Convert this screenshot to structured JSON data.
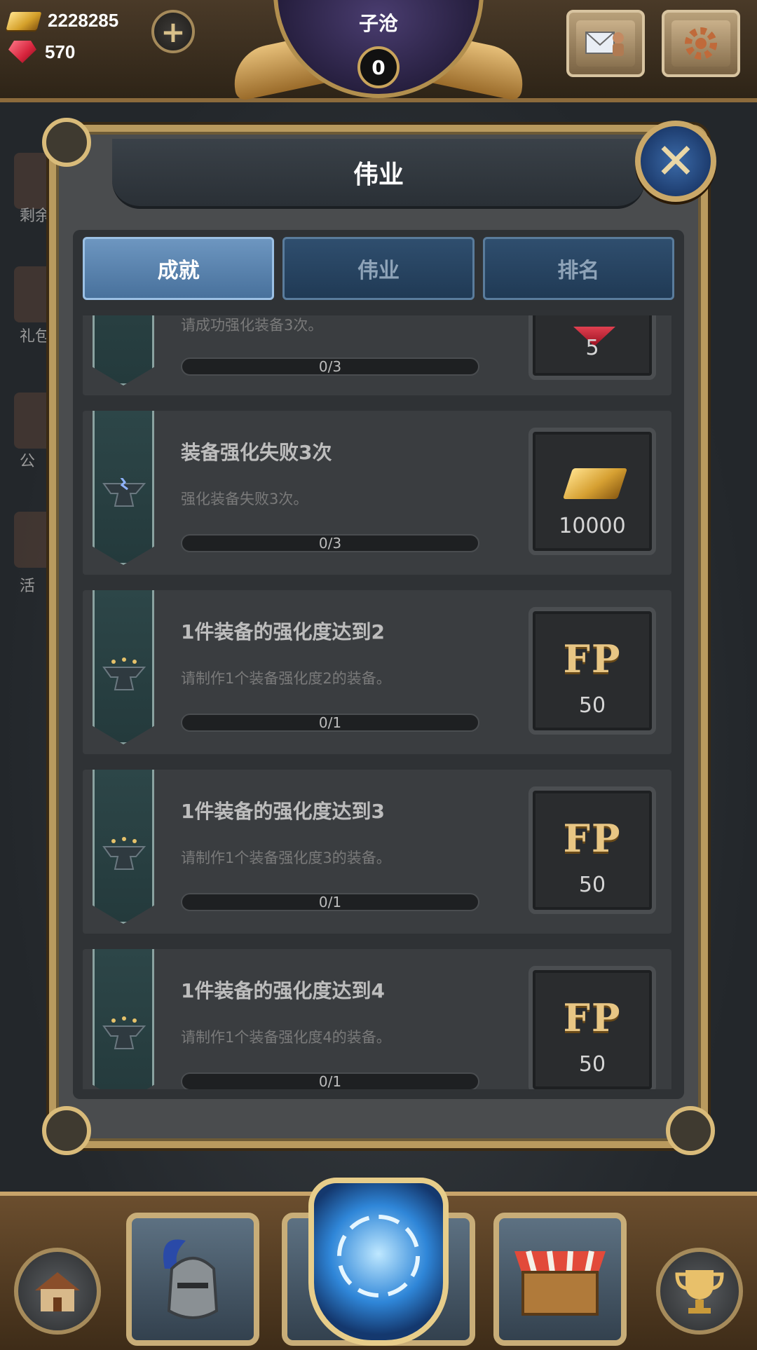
{
  "resources": {
    "gold": "2228285",
    "gems": "570"
  },
  "player": {
    "name": "子沧",
    "level": "0"
  },
  "side_labels": [
    "剩余",
    "礼包",
    "公",
    "活"
  ],
  "panel": {
    "title": "伟业"
  },
  "tabs": [
    {
      "label": "成就",
      "active": true
    },
    {
      "label": "伟业",
      "active": false
    },
    {
      "label": "排名",
      "active": false
    }
  ],
  "achievements": [
    {
      "title": "",
      "description": "请成功强化装备3次。",
      "progress": "0/3",
      "progress_fraction": 0,
      "reward_type": "ruby",
      "reward_amount": "5"
    },
    {
      "title": "装备强化失败3次",
      "description": "强化装备失败3次。",
      "progress": "0/3",
      "progress_fraction": 0,
      "reward_type": "gold",
      "reward_amount": "10000"
    },
    {
      "title": "1件装备的强化度达到2",
      "description": "请制作1个装备强化度2的装备。",
      "progress": "0/1",
      "progress_fraction": 0,
      "reward_type": "fp",
      "reward_icon_text": "FP",
      "reward_amount": "50"
    },
    {
      "title": "1件装备的强化度达到3",
      "description": "请制作1个装备强化度3的装备。",
      "progress": "0/1",
      "progress_fraction": 0,
      "reward_type": "fp",
      "reward_icon_text": "FP",
      "reward_amount": "50"
    },
    {
      "title": "1件装备的强化度达到4",
      "description": "请制作1个装备强化度4的装备。",
      "progress": "0/1",
      "progress_fraction": 0,
      "reward_type": "fp",
      "reward_icon_text": "FP",
      "reward_amount": "50"
    }
  ],
  "bottom_nav": [
    "home-icon",
    "knight-helmet-icon",
    "portal-icon",
    "shop-stall-icon",
    "trophy-icon"
  ]
}
